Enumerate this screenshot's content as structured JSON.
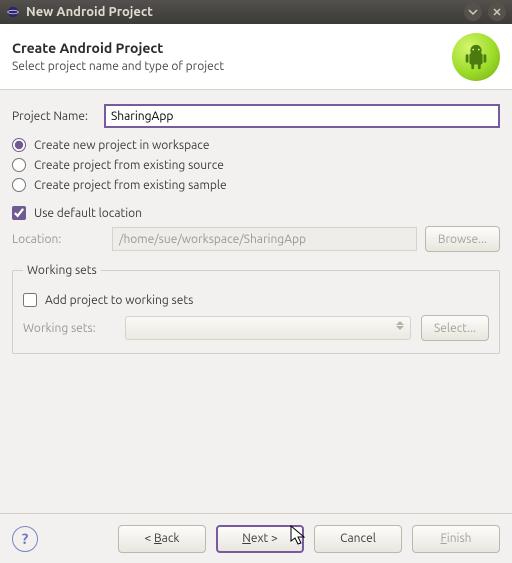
{
  "window": {
    "title": "New Android Project"
  },
  "banner": {
    "heading": "Create Android Project",
    "subheading": "Select project name and type of project"
  },
  "project_name": {
    "label": "Project Name:",
    "value": "SharingApp"
  },
  "radios": {
    "new_workspace": "Create new project in workspace",
    "existing_source": "Create project from existing source",
    "existing_sample": "Create project from existing sample"
  },
  "default_location": {
    "label": "Use default location"
  },
  "location": {
    "label": "Location:",
    "value": "/home/sue/workspace/SharingApp",
    "browse": "Browse..."
  },
  "working_sets": {
    "legend": "Working sets",
    "add_label": "Add project to working sets",
    "combo_label": "Working sets:",
    "select": "Select..."
  },
  "footer": {
    "back_prefix": "< ",
    "back_u": "B",
    "back_rest": "ack",
    "next_u": "N",
    "next_rest": "ext >",
    "cancel": "Cancel",
    "finish_u": "F",
    "finish_rest": "inish"
  }
}
